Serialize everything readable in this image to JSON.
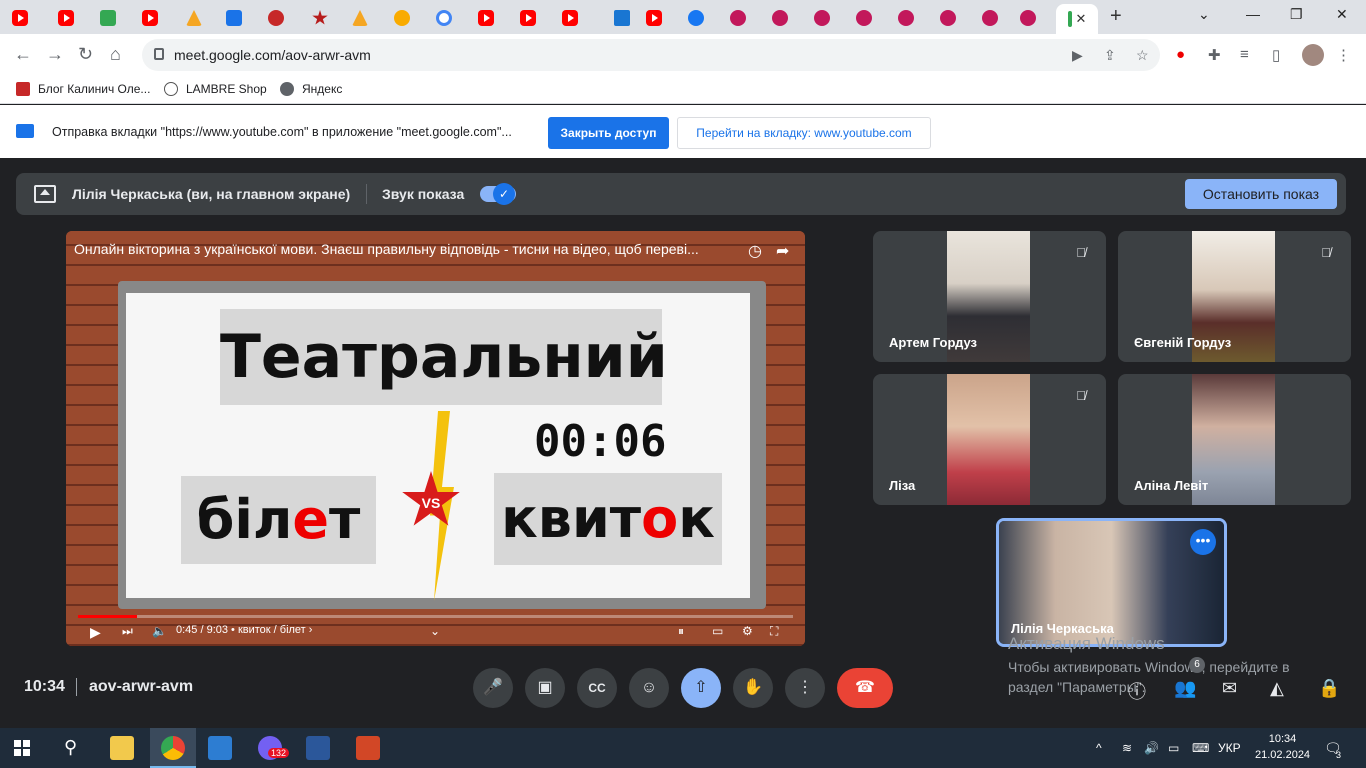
{
  "browser": {
    "url": "meet.google.com/aov-arwr-avm",
    "bookmarks": [
      "Блог Калинич Оле...",
      "LAMBRE Shop",
      "Яндекс"
    ]
  },
  "infobar": {
    "message": "Отправка вкладки \"https://www.youtube.com\" в приложение \"meet.google.com\"...",
    "primary_button": "Закрыть доступ",
    "secondary_button": "Перейти на вкладку: www.youtube.com"
  },
  "presentation_bar": {
    "title": "Лілія Черкаська (ви, на главном экране)",
    "sound_label": "Звук показа",
    "stop_button": "Остановить показ"
  },
  "video": {
    "title": "Онлайн вікторина з української мови. Знаєш правильну відповідь - тисни на відео, щоб переві...",
    "board_word": "Театральний",
    "timer": "00:06",
    "left_word": "білет",
    "right_word": "квиток",
    "vs_label": "VS",
    "time_display": "0:45 / 9:03 • квиток / білет ›",
    "progress": 0.083
  },
  "participants": [
    {
      "name": "Артем Гордуз",
      "muted": true
    },
    {
      "name": "Євгеній Гордуз",
      "muted": true
    },
    {
      "name": "Ліза",
      "muted": true
    },
    {
      "name": "Аліна Левіт",
      "muted": false
    }
  ],
  "self": {
    "name": "Лілія Черкаська"
  },
  "meeting": {
    "time": "10:34",
    "code": "aov-arwr-avm",
    "participant_count": "6"
  },
  "watermark": {
    "line1": "Активация Windows",
    "line2": "Чтобы активировать Windows, перейдите в раздел \"Параметры\"."
  },
  "taskbar": {
    "viber_badge": "132",
    "language": "УКР",
    "time": "10:34",
    "date": "21.02.2024",
    "notifications": "3"
  },
  "colors": {
    "accent": "#8ab4f8",
    "end_call": "#ea4335",
    "meet_bg": "#202124"
  }
}
